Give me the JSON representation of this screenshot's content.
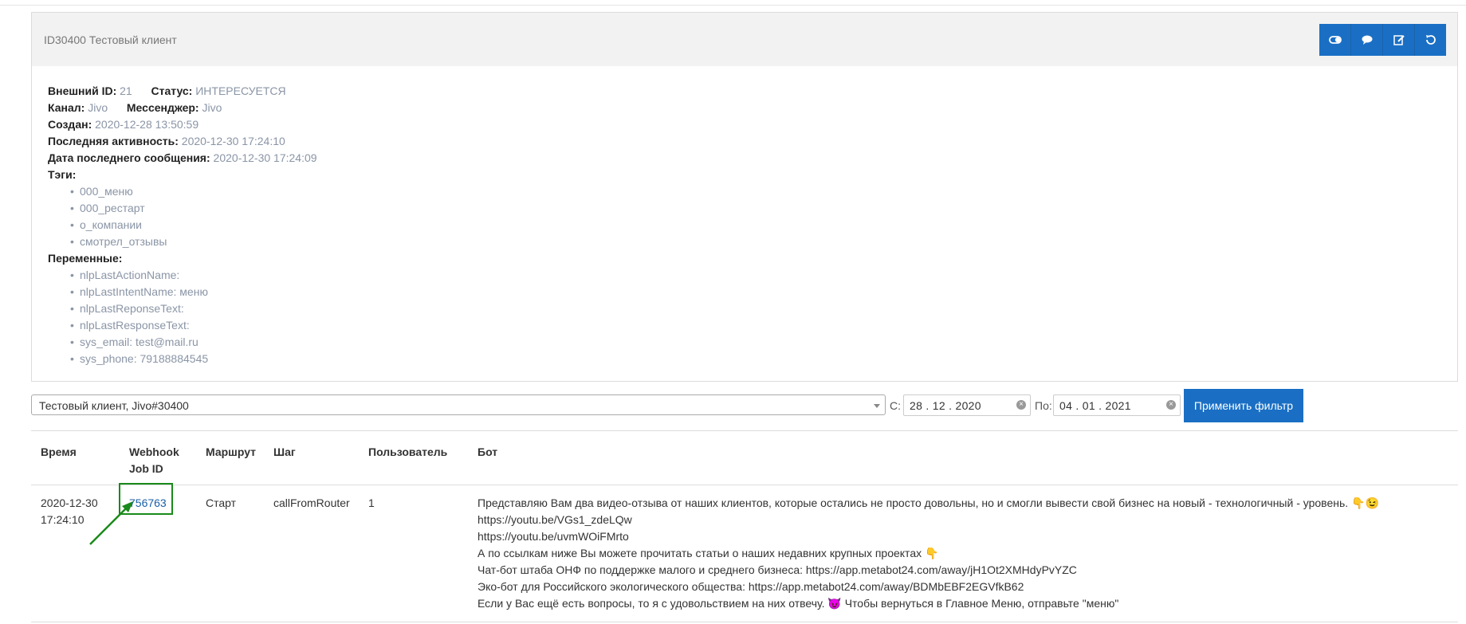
{
  "card": {
    "title": "ID30400 Тестовый клиент",
    "actions": [
      "toggle-icon",
      "chat-icon",
      "edit-icon",
      "refresh-icon"
    ],
    "fields": {
      "external_id_label": "Внешний ID:",
      "external_id": "21",
      "status_label": "Статус:",
      "status": "ИНТЕРЕСУЕТСЯ",
      "channel_label": "Канал:",
      "channel": "Jivo",
      "messenger_label": "Мессенджер:",
      "messenger": "Jivo",
      "created_label": "Создан:",
      "created": "2020-12-28 13:50:59",
      "last_activity_label": "Последняя активность:",
      "last_activity": "2020-12-30 17:24:10",
      "last_message_label": "Дата последнего сообщения:",
      "last_message": "2020-12-30 17:24:09",
      "tags_label": "Тэги:",
      "tags": [
        "000_меню",
        "000_рестарт",
        "о_компании",
        "смотрел_отзывы"
      ],
      "variables_label": "Переменные:",
      "variables": [
        "nlpLastActionName:",
        "nlpLastIntentName: меню",
        "nlpLastReponseText:",
        "nlpLastResponseText:",
        "sys_email: test@mail.ru",
        "sys_phone: 79188884545"
      ]
    }
  },
  "filter": {
    "client": "Тестовый клиент, Jivo#30400",
    "from_label": "С:",
    "from_date": "28 . 12 . 2020",
    "to_label": "По:",
    "to_date": "04 . 01 . 2021",
    "apply_label": "Применить фильтр"
  },
  "table": {
    "headers": {
      "time": "Время",
      "job_id_1": "Webhook",
      "job_id_2": "Job ID",
      "route": "Маршрут",
      "step": "Шаг",
      "user": "Пользователь",
      "bot": "Бот"
    },
    "rows": [
      {
        "time_date": "2020-12-30",
        "time_clock": "17:24:10",
        "job_id": "756763",
        "route": "Старт",
        "step": "callFromRouter",
        "user": "1",
        "bot_lines": [
          "Представляю Вам два видео-отзыва от наших клиентов, которые остались не просто довольны, но и смогли вывести свой бизнес на новый - технологичный - уровень. 👇😉",
          "https://youtu.be/VGs1_zdeLQw",
          "https://youtu.be/uvmWOiFMrto",
          "А по ссылкам ниже Вы можете прочитать статьи о наших недавних крупных проектах 👇",
          "Чат-бот штаба ОНФ по поддержке малого и среднего бизнеса: https://app.metabot24.com/away/jH1Ot2XMHdyPvYZC",
          "Эко-бот для Российского экологического общества: https://app.metabot24.com/away/BDMbEBF2EGVfkB62",
          "Если у Вас ещё есть вопросы, то я с удовольствием на них отвечу. 😈 Чтобы вернуться в Главное Меню, отправьте \"меню\""
        ]
      }
    ]
  },
  "colors": {
    "accent": "#1a6fc4",
    "highlight": "#1a8a1a",
    "muted": "#8a95a6"
  }
}
